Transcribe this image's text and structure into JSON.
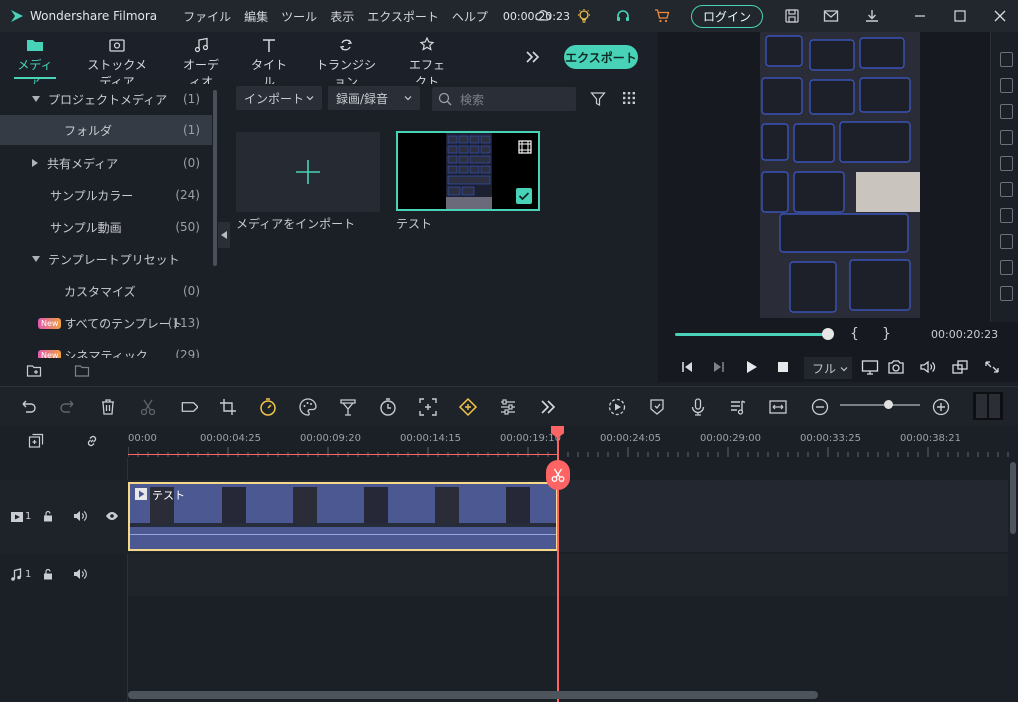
{
  "app": {
    "title": "Wondershare Filmora",
    "menu": [
      "ファイル",
      "編集",
      "ツール",
      "表示",
      "エクスポート",
      "ヘルプ"
    ],
    "timecode": "00:00:20:23",
    "login_label": "ログイン"
  },
  "media_tabs": [
    {
      "label": "メディア",
      "icon": "folder-icon",
      "active": true
    },
    {
      "label": "ストックメディア",
      "icon": "stock-media-icon",
      "active": false
    },
    {
      "label": "オーディオ",
      "icon": "music-note-icon",
      "active": false
    },
    {
      "label": "タイトル",
      "icon": "text-t-icon",
      "active": false
    },
    {
      "label": "トランジション",
      "icon": "transition-icon",
      "active": false
    },
    {
      "label": "エフェクト",
      "icon": "effects-icon",
      "active": false
    }
  ],
  "export_label": "エクスポート",
  "library": {
    "items": [
      {
        "label": "プロジェクトメディア",
        "count": "(1)"
      },
      {
        "label": "フォルダ",
        "count": "(1)"
      },
      {
        "label": "共有メディア",
        "count": "(0)"
      },
      {
        "label": "サンプルカラー",
        "count": "(24)"
      },
      {
        "label": "サンプル動画",
        "count": "(50)"
      },
      {
        "label": "テンプレートプリセット",
        "count": ""
      },
      {
        "label": "カスタマイズ",
        "count": "(0)"
      },
      {
        "label": "すべてのテンプレート",
        "count": "(113)"
      },
      {
        "label": "シネマティック",
        "count": "(29)"
      }
    ],
    "new_badge": "New"
  },
  "media_toolbar": {
    "import_label": "インポート",
    "record_label": "録画/録音",
    "search_placeholder": "検索"
  },
  "media_items": {
    "import_tile_label": "メディアをインポート",
    "clip_label": "テスト"
  },
  "preview": {
    "time": "00:00:20:23",
    "bracket_in": "{",
    "bracket_out": "}",
    "quality": "フル",
    "progress": 1.0
  },
  "timeline": {
    "ticks": [
      "00:00",
      "00:00:04:25",
      "00:00:09:20",
      "00:00:14:15",
      "00:00:19:10",
      "00:00:24:05",
      "00:00:29:00",
      "00:00:33:25",
      "00:00:38:21"
    ],
    "video_track_num": "1",
    "audio_track_num": "1",
    "clip_title": "テスト",
    "zoom_level": 0.55
  },
  "colors": {
    "accent": "#48d3b8",
    "playhead": "#ff6464",
    "clip_border": "#f5d98a",
    "clip_fill": "#4c5891"
  }
}
